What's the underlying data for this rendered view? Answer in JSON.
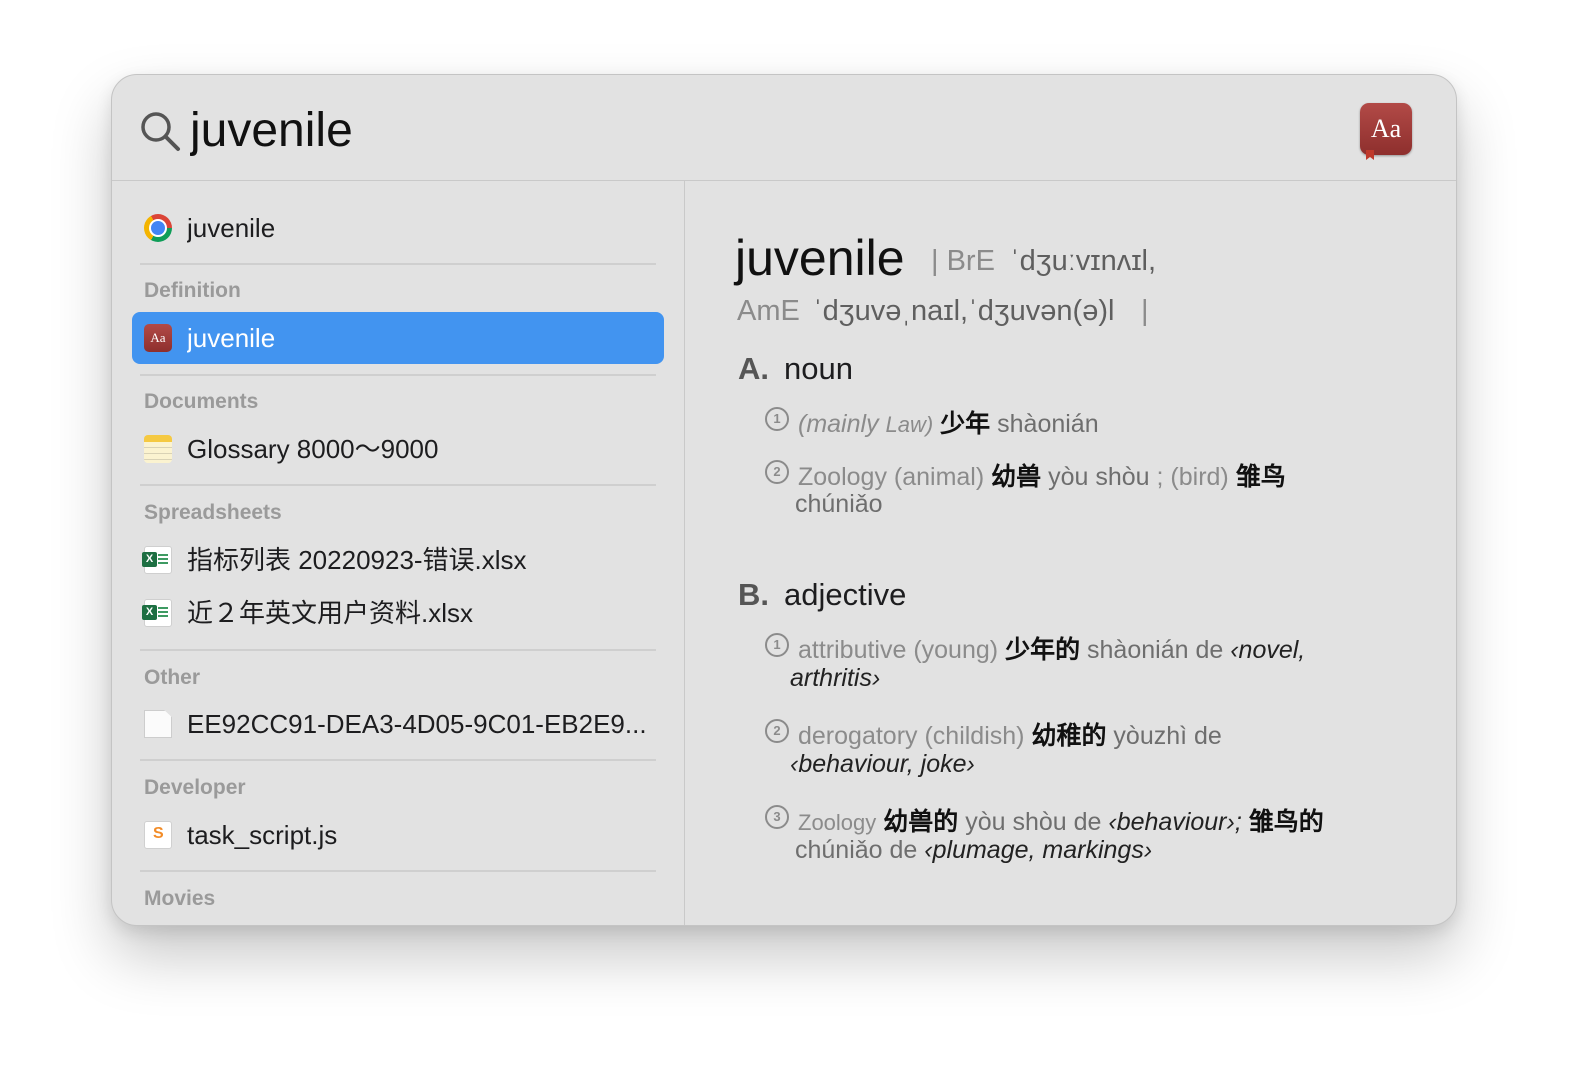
{
  "search": {
    "query": "juvenile"
  },
  "app_icon": {
    "label": "Aa",
    "color": "#a33b38"
  },
  "results": {
    "top_hit": {
      "label": "juvenile",
      "icon": "chrome-icon"
    },
    "sections": [
      {
        "header": "Definition",
        "items": [
          {
            "label": "juvenile",
            "icon": "dictionary-icon",
            "selected": true
          }
        ]
      },
      {
        "header": "Documents",
        "items": [
          {
            "label": "Glossary 8000～9000",
            "icon": "notes-icon"
          }
        ]
      },
      {
        "header": "Spreadsheets",
        "items": [
          {
            "label": "指标列表 20220923-错误.xlsx",
            "icon": "excel-icon"
          },
          {
            "label": "近２年英文用户资料.xlsx",
            "icon": "excel-icon"
          }
        ]
      },
      {
        "header": "Other",
        "items": [
          {
            "label": "EE92CC91-DEA3-4D05-9C01-EB2E9...",
            "icon": "file-icon"
          }
        ]
      },
      {
        "header": "Developer",
        "items": [
          {
            "label": "task_script.js",
            "icon": "js-file-icon"
          }
        ]
      },
      {
        "header": "Movies",
        "items": []
      }
    ],
    "selected_color": "#4294f0"
  },
  "definition": {
    "headword": "juvenile",
    "bre_prefix": "| BrE",
    "bre_ipa": "ˈdʒuːvɪnʌɪl,",
    "ame_prefix": "AmE",
    "ame_ipa": "ˈdʒuvəˌnaɪl,ˈdʒuvən(ə)l",
    "pron_end": "|",
    "noun": {
      "letter": "A.",
      "word": "noun",
      "senses": [
        {
          "num": "1",
          "label": "(mainly",
          "label2": "Law)",
          "zh": "少年",
          "pinyin": "shàonián"
        },
        {
          "num": "2",
          "label": "Zoology (animal)",
          "zh": "幼兽",
          "pinyin": "yòu shòu",
          "sep": "; (bird)",
          "zh2": "雏鸟",
          "pinyin2": "chúniǎo"
        }
      ]
    },
    "adjective": {
      "letter": "B.",
      "word": "adjective",
      "senses": [
        {
          "num": "1",
          "label": "attributive (young)",
          "zh": "少年的",
          "pinyin": "shàonián de",
          "ex": "‹novel,",
          "ex2": "arthritis›"
        },
        {
          "num": "2",
          "label": "derogatory (childish)",
          "zh": "幼稚的",
          "pinyin": "yòuzhì de",
          "ex2": "‹behaviour, joke›"
        },
        {
          "num": "3",
          "label": "Zoology",
          "zh": "幼兽的",
          "pinyin": "yòu shòu de",
          "ex": "‹behaviour›;",
          "zh2": "雏鸟的",
          "pinyin2": "chúniǎo de",
          "ex2": "‹plumage, markings›"
        }
      ]
    }
  }
}
